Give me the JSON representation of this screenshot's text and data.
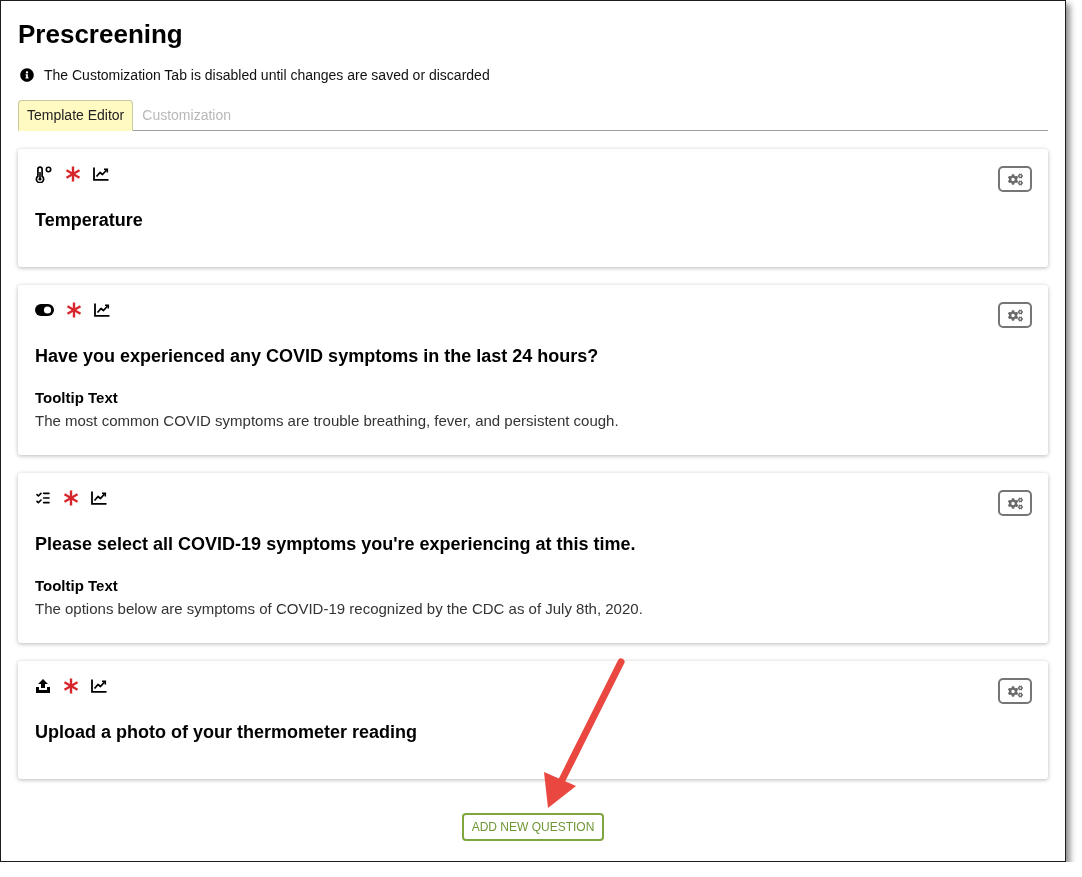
{
  "page": {
    "title": "Prescreening",
    "notice": "The Customization Tab is disabled until changes are saved or discarded"
  },
  "tabs": [
    {
      "label": "Template Editor",
      "selected": true,
      "disabled": false
    },
    {
      "label": "Customization",
      "selected": false,
      "disabled": true
    }
  ],
  "questions": [
    {
      "kind": "temperature",
      "required": true,
      "reported": true,
      "title": "Temperature"
    },
    {
      "kind": "toggle",
      "required": true,
      "reported": true,
      "title": "Have you experienced any COVID symptoms in the last 24 hours?",
      "tooltip": {
        "label": "Tooltip Text",
        "text": "The most common COVID symptoms are trouble breathing, fever, and persistent cough."
      }
    },
    {
      "kind": "checklist",
      "required": true,
      "reported": true,
      "title": "Please select all COVID-19 symptoms you're experiencing at this time.",
      "tooltip": {
        "label": "Tooltip Text",
        "text": "The options below are symptoms of COVID-19 recognized by the CDC as of July 8th, 2020."
      }
    },
    {
      "kind": "upload",
      "required": true,
      "reported": true,
      "title": "Upload a photo of your thermometer reading"
    }
  ],
  "add_button": {
    "label": "ADD NEW QUESTION"
  }
}
